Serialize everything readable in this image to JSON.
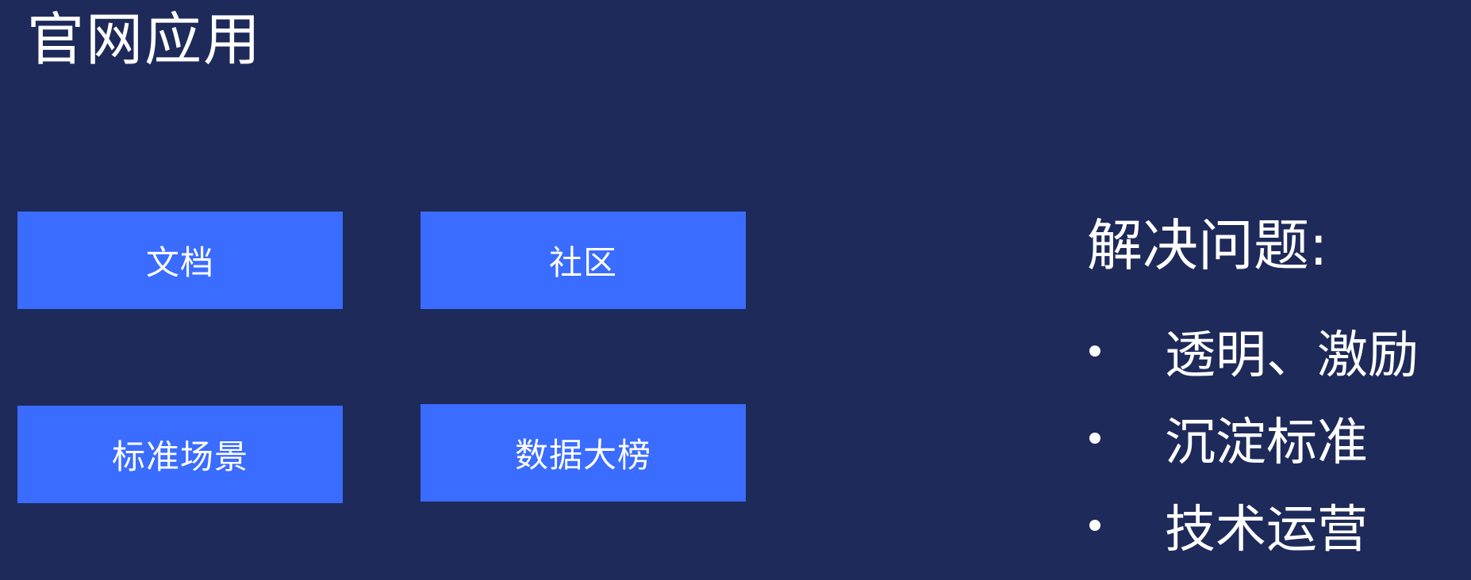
{
  "slide": {
    "title": "官网应用"
  },
  "tiles": [
    {
      "label": "文档"
    },
    {
      "label": "社区"
    },
    {
      "label": "标准场景"
    },
    {
      "label": "数据大榜"
    }
  ],
  "problems": {
    "heading": "解决问题:",
    "items": [
      {
        "text": "透明、激励"
      },
      {
        "text": "沉淀标准"
      },
      {
        "text": "技术运营"
      }
    ]
  },
  "colors": {
    "background": "#1e2a5a",
    "tile": "#3a6cff",
    "text": "#ffffff"
  }
}
